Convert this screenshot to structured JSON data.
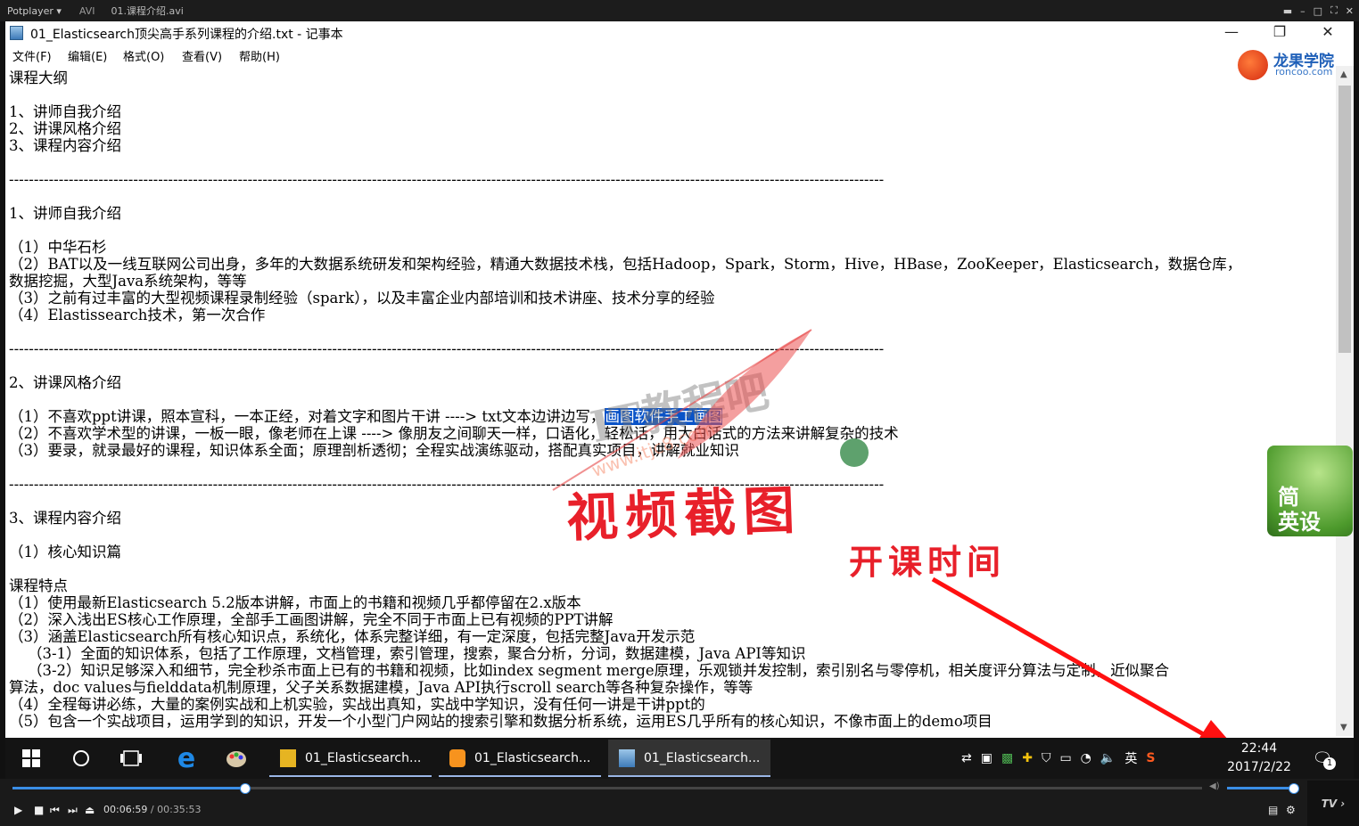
{
  "player": {
    "brand": "Potplayer ▾",
    "format": "AVI",
    "filename": "01.课程介绍.avi",
    "time_current": "00:06:59",
    "time_separator": " / ",
    "time_total": "00:35:53",
    "progress": 0.195,
    "volume": 1.0,
    "tv_label": "TV ›"
  },
  "notepad": {
    "title": "01_Elasticsearch顶尖高手系列课程的介绍.txt - 记事本",
    "menu": [
      "文件(F)",
      "编辑(E)",
      "格式(O)",
      "查看(V)",
      "帮助(H)"
    ],
    "selected_text": "画图软件手工画图"
  },
  "text_lines": [
    "课程大纲",
    "",
    "1、讲师自我介绍",
    "2、讲课风格介绍",
    "3、课程内容介绍",
    "",
    "--------------------------------------------------------------------------------------------------------------------------------------------------------------------------------",
    "",
    "1、讲师自我介绍",
    "",
    "（1）中华石杉",
    "（2）BAT以及一线互联网公司出身，多年的大数据系统研发和架构经验，精通大数据技术栈，包括Hadoop，Spark，Storm，Hive，HBase，ZooKeeper，Elasticsearch，数据仓库，",
    "数据挖掘，大型Java系统架构，等等",
    "（3）之前有过丰富的大型视频课程录制经验（spark），以及丰富企业内部培训和技术讲座、技术分享的经验",
    "（4）Elastissearch技术，第一次合作",
    "",
    "--------------------------------------------------------------------------------------------------------------------------------------------------------------------------------",
    "",
    "2、讲课风格介绍",
    "",
    "（1）不喜欢ppt讲课，照本宣科，一本正经，对着文字和图片干讲 ----> txt文本边讲边写，",
    "（2）不喜欢学术型的讲课，一板一眼，像老师在上课 ----> 像朋友之间聊天一样，口语化，轻松话，用大白话式的方法来讲解复杂的技术",
    "（3）要录，就录最好的课程，知识体系全面；原理剖析透彻；全程实战演练驱动，搭配真实项目，讲解就业知识",
    "",
    "--------------------------------------------------------------------------------------------------------------------------------------------------------------------------------",
    "",
    "3、课程内容介绍",
    "",
    "（1）核心知识篇",
    "",
    "课程特点",
    "（1）使用最新Elasticsearch 5.2版本讲解，市面上的书籍和视频几乎都停留在2.x版本",
    "（2）深入浅出ES核心工作原理，全部手工画图讲解，完全不同于市面上已有视频的PPT讲解",
    "（3）涵盖Elasticsearch所有核心知识点，系统化，体系完整详细，有一定深度，包括完整Java开发示范",
    "    （3-1）全面的知识体系，包括了工作原理，文档管理，索引管理，搜索，聚合分析，分词，数据建模，Java API等知识",
    "    （3-2）知识足够深入和细节，完全秒杀市面上已有的书籍和视频，比如index segment merge原理，乐观锁并发控制，索引别名与零停机，相关度评分算法与定制，近似聚合",
    "算法，doc values与fielddata机制原理，父子关系数据建模，Java API执行scroll search等各种复杂操作，等等",
    "（4）全程每讲必练，大量的案例实战和上机实验，实战出真知，实战中学知识，没有任何一讲是干讲ppt的",
    "（5）包含一个实战项目，运用学到的知识，开发一个小型门户网站的搜索引擎和数据分析系统，运用ES几乎所有的核心知识，不像市面上的demo项目"
  ],
  "overlays": {
    "logo_name": "龙果学院",
    "logo_url": "roncoo.com",
    "watermark_cn": "IT教程吧",
    "watermark_url": "www.itjc8.com",
    "watermark_big": "视频截图",
    "annotation": "开课时间",
    "ime_line1": "简",
    "ime_line2": "英设"
  },
  "taskbar": {
    "tasks": [
      {
        "label": "01_Elasticsearch...",
        "icon": "folder-icon"
      },
      {
        "label": "01_Elasticsearch...",
        "icon": "potplayer-icon"
      },
      {
        "label": "01_Elasticsearch...",
        "icon": "notepad-icon"
      }
    ],
    "ime_indicator": "英",
    "time": "22:44",
    "date": "2017/2/22",
    "notification_count": "1"
  },
  "colors": {
    "selection": "#0a53c8",
    "accent": "#3a8ee6",
    "annotation_red": "#e8202a"
  }
}
